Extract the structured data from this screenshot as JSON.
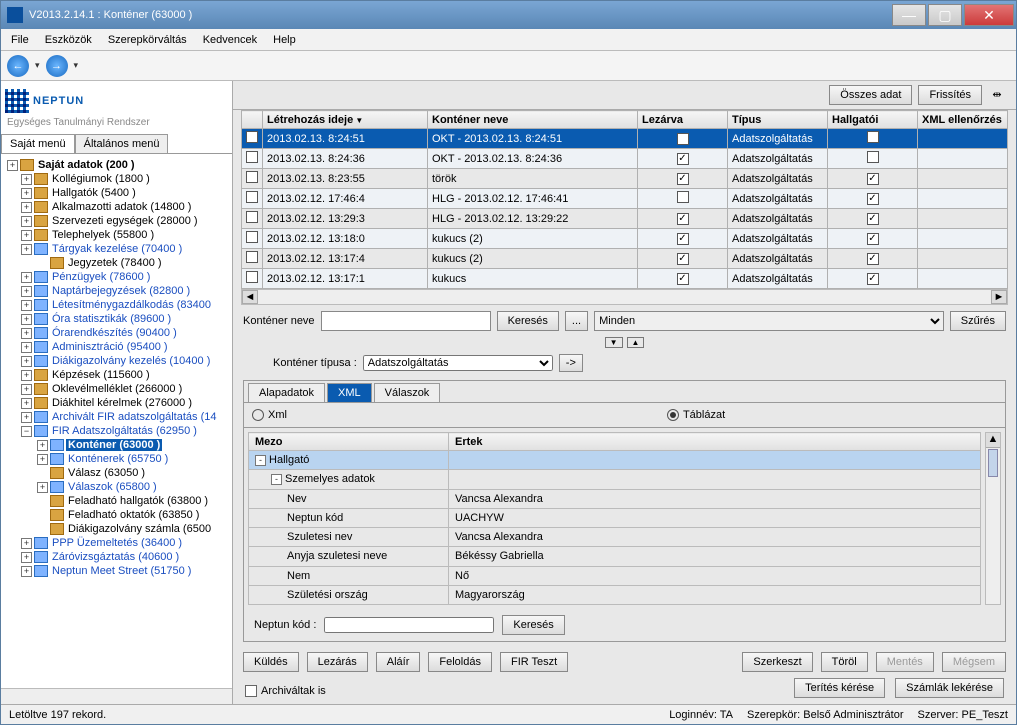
{
  "window": {
    "title": "V2013.2.14.1 : Konténer (63000  )"
  },
  "menu": [
    "File",
    "Eszközök",
    "Szerepkörváltás",
    "Kedvencek",
    "Help"
  ],
  "logo": {
    "name": "NEPTUN",
    "slogan": "Egységes Tanulmányi Rendszer"
  },
  "leftTabs": {
    "own": "Saját menü",
    "all": "Általános menü"
  },
  "tree": [
    {
      "lbl": "Saját adatok (200  )",
      "bold": true,
      "ico": "o"
    },
    {
      "lbl": "Kollégiumok (1800  )",
      "ico": "o",
      "ind": 1
    },
    {
      "lbl": "Hallgatók (5400  )",
      "ico": "o",
      "ind": 1
    },
    {
      "lbl": "Alkalmazotti adatok (14800  )",
      "ico": "o",
      "ind": 1
    },
    {
      "lbl": "Szervezeti egységek (28000  )",
      "ico": "o",
      "ind": 1
    },
    {
      "lbl": "Telephelyek (55800  )",
      "ico": "o",
      "ind": 1
    },
    {
      "lbl": "Tárgyak kezelése (70400  )",
      "ico": "b",
      "link": true,
      "ind": 1
    },
    {
      "lbl": "Jegyzetek (78400  )",
      "ico": "o",
      "ind": 2,
      "noplus": true
    },
    {
      "lbl": "Pénzügyek (78600  )",
      "ico": "b",
      "link": true,
      "ind": 1
    },
    {
      "lbl": "Naptárbejegyzések (82800  )",
      "ico": "b",
      "link": true,
      "ind": 1
    },
    {
      "lbl": "Létesítménygazdálkodás (83400",
      "ico": "b",
      "link": true,
      "ind": 1
    },
    {
      "lbl": "Óra statisztikák (89600  )",
      "ico": "b",
      "link": true,
      "ind": 1
    },
    {
      "lbl": "Órarendkészítés (90400  )",
      "ico": "b",
      "link": true,
      "ind": 1
    },
    {
      "lbl": "Adminisztráció (95400  )",
      "ico": "b",
      "link": true,
      "ind": 1
    },
    {
      "lbl": "Diákigazolvány kezelés (10400  )",
      "ico": "b",
      "link": true,
      "ind": 1
    },
    {
      "lbl": "Képzések (115600  )",
      "ico": "o",
      "ind": 1
    },
    {
      "lbl": "Oklevélmelléklet (266000  )",
      "ico": "o",
      "ind": 1
    },
    {
      "lbl": "Diákhitel kérelmek (276000  )",
      "ico": "o",
      "ind": 1
    },
    {
      "lbl": "Archivált FIR adatszolgáltatás (14",
      "ico": "b",
      "link": true,
      "ind": 1
    },
    {
      "lbl": "FIR Adatszolgáltatás (62950  )",
      "ico": "b",
      "link": true,
      "ind": 1,
      "minus": true
    },
    {
      "lbl": "Konténer (63000  )",
      "ico": "b",
      "link": true,
      "ind": 2,
      "sel": true
    },
    {
      "lbl": "Konténerek (65750  )",
      "ico": "b",
      "link": true,
      "ind": 2
    },
    {
      "lbl": "Válasz (63050  )",
      "ico": "o",
      "ind": 2,
      "noplus": true
    },
    {
      "lbl": "Válaszok (65800  )",
      "ico": "b",
      "link": true,
      "ind": 2
    },
    {
      "lbl": "Feladható hallgatók (63800  )",
      "ico": "o",
      "ind": 2,
      "noplus": true
    },
    {
      "lbl": "Feladható oktatók (63850  )",
      "ico": "o",
      "ind": 2,
      "noplus": true
    },
    {
      "lbl": "Diákigazolvány számla (6500",
      "ico": "o",
      "ind": 2,
      "noplus": true
    },
    {
      "lbl": "PPP Üzemeltetés (36400  )",
      "ico": "b",
      "link": true,
      "ind": 1
    },
    {
      "lbl": "Záróvizsgáztatás (40600  )",
      "ico": "b",
      "link": true,
      "ind": 1
    },
    {
      "lbl": "Neptun Meet Street (51750  )",
      "ico": "b",
      "link": true,
      "ind": 1
    }
  ],
  "topButtons": {
    "all": "Összes adat",
    "refresh": "Frissítés"
  },
  "gridHeaders": [
    "Létrehozás ideje",
    "Konténer neve",
    "Lezárva",
    "Típus",
    "Hallgatói",
    "XML ellenőrzés"
  ],
  "gridRows": [
    {
      "t": "2013.02.13. 8:24:51",
      "n": "OKT - 2013.02.13. 8:24:51",
      "l": true,
      "typ": "Adatszolgáltatás",
      "h": false,
      "sel": true
    },
    {
      "t": "2013.02.13. 8:24:36",
      "n": "OKT - 2013.02.13. 8:24:36",
      "l": true,
      "typ": "Adatszolgáltatás",
      "h": false
    },
    {
      "t": "2013.02.13. 8:23:55",
      "n": "török",
      "l": true,
      "typ": "Adatszolgáltatás",
      "h": true
    },
    {
      "t": "2013.02.12. 17:46:4",
      "n": "HLG - 2013.02.12. 17:46:41",
      "l": false,
      "typ": "Adatszolgáltatás",
      "h": true
    },
    {
      "t": "2013.02.12. 13:29:3",
      "n": "HLG - 2013.02.12. 13:29:22",
      "l": true,
      "typ": "Adatszolgáltatás",
      "h": true
    },
    {
      "t": "2013.02.12. 13:18:0",
      "n": "kukucs (2)",
      "l": true,
      "typ": "Adatszolgáltatás",
      "h": true
    },
    {
      "t": "2013.02.12. 13:17:4",
      "n": "kukucs (2)",
      "l": true,
      "typ": "Adatszolgáltatás",
      "h": true
    },
    {
      "t": "2013.02.12. 13:17:1",
      "n": "kukucs",
      "l": true,
      "typ": "Adatszolgáltatás",
      "h": true
    }
  ],
  "search": {
    "label": "Konténer neve",
    "btn": "Keresés",
    "dots": "...",
    "dropdown": "Minden",
    "filter": "Szűrés"
  },
  "typeRow": {
    "label": "Konténer típusa :",
    "value": "Adatszolgáltatás",
    "go": "->"
  },
  "innerTabs": [
    "Alapadatok",
    "XML",
    "Válaszok"
  ],
  "radios": {
    "xml": "Xml",
    "table": "Táblázat"
  },
  "dg": {
    "headers": [
      "Mezo",
      "Ertek"
    ],
    "rows": [
      {
        "m": "Hallgató",
        "v": "",
        "hi": true,
        "exp": "-",
        "ind": 0
      },
      {
        "m": "Szemelyes adatok",
        "v": "",
        "exp": "-",
        "ind": 1
      },
      {
        "m": "Nev",
        "v": "Vancsa Alexandra",
        "ind": 2
      },
      {
        "m": "Neptun kód",
        "v": "UACHYW",
        "ind": 2
      },
      {
        "m": "Szuletesi nev",
        "v": "Vancsa Alexandra",
        "ind": 2
      },
      {
        "m": "Anyja szuletesi neve",
        "v": "Békéssy Gabriella",
        "ind": 2
      },
      {
        "m": "Nem",
        "v": "Nő",
        "ind": 2
      },
      {
        "m": "Születési ország",
        "v": "Magyarország",
        "ind": 2
      }
    ]
  },
  "neptunRow": {
    "label": "Neptun kód :",
    "btn": "Keresés"
  },
  "btns": {
    "kuldes": "Küldés",
    "lezaras": "Lezárás",
    "alair": "Aláír",
    "feloldas": "Feloldás",
    "fir": "FIR Teszt",
    "szerkeszt": "Szerkeszt",
    "torol": "Töröl",
    "mentes": "Mentés",
    "megsem": "Mégsem"
  },
  "archChk": "Archiváltak is",
  "secondBtns": {
    "terites": "Terítés kérése",
    "szamlak": "Számlák lekérése"
  },
  "status": {
    "left": "Letöltve 197 rekord.",
    "login": "Loginnév: TA",
    "role": "Szerepkör: Belső Adminisztrátor",
    "server": "Szerver: PE_Teszt"
  }
}
